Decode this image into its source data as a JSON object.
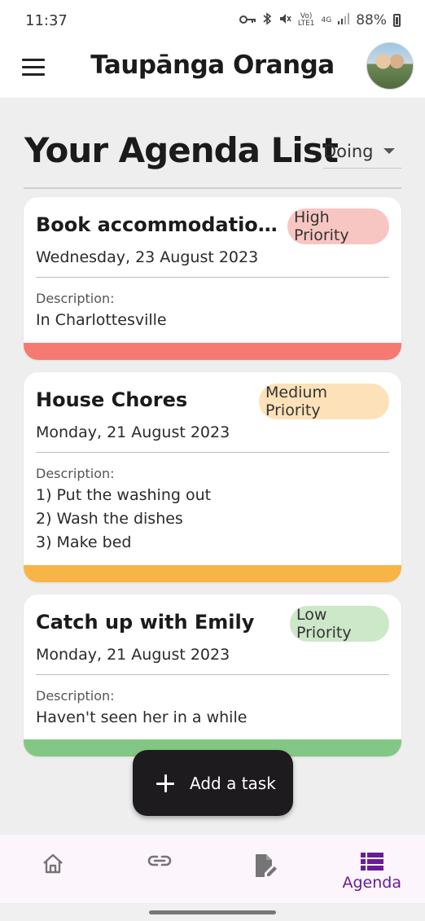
{
  "status_bar": {
    "time": "11:37",
    "volte_top": "Vo)",
    "volte_bottom": "LTE1",
    "network": "4G",
    "battery": "88%"
  },
  "app_bar": {
    "title": "Taupānga Oranga",
    "menu_icon": "hamburger-menu-icon",
    "avatar": "profile-photo"
  },
  "page": {
    "heading": "Your Agenda List",
    "filter_value": "Doing"
  },
  "tasks": [
    {
      "title": "Book accommodation fo...",
      "priority": "High Priority",
      "priority_color": "#f7c6c3",
      "stripe_color": "#f47a72",
      "date": "Wednesday, 23 August 2023",
      "description_label": "Description:",
      "description": [
        "In Charlottesville"
      ]
    },
    {
      "title": "House Chores",
      "priority": "Medium Priority",
      "priority_color": "#fde1b9",
      "stripe_color": "#f8b447",
      "date": "Monday, 21 August 2023",
      "description_label": "Description:",
      "description": [
        "1) Put the washing out",
        "2) Wash the dishes",
        "3) Make bed"
      ]
    },
    {
      "title": "Catch up with Emily",
      "priority": "Low Priority",
      "priority_color": "#cde7c9",
      "stripe_color": "#83c784",
      "date": "Monday, 21 August 2023",
      "description_label": "Description:",
      "description": [
        "Haven't seen her in a while"
      ]
    }
  ],
  "fab": {
    "icon": "plus-icon",
    "label": "Add a task"
  },
  "bottom_nav": {
    "items": [
      {
        "icon": "home-icon",
        "label": ""
      },
      {
        "icon": "link-icon",
        "label": ""
      },
      {
        "icon": "edit-document-icon",
        "label": ""
      },
      {
        "icon": "agenda-list-icon",
        "label": "Agenda",
        "active": true
      }
    ],
    "active_color": "#6a1b9a",
    "inactive_color": "#757575"
  }
}
